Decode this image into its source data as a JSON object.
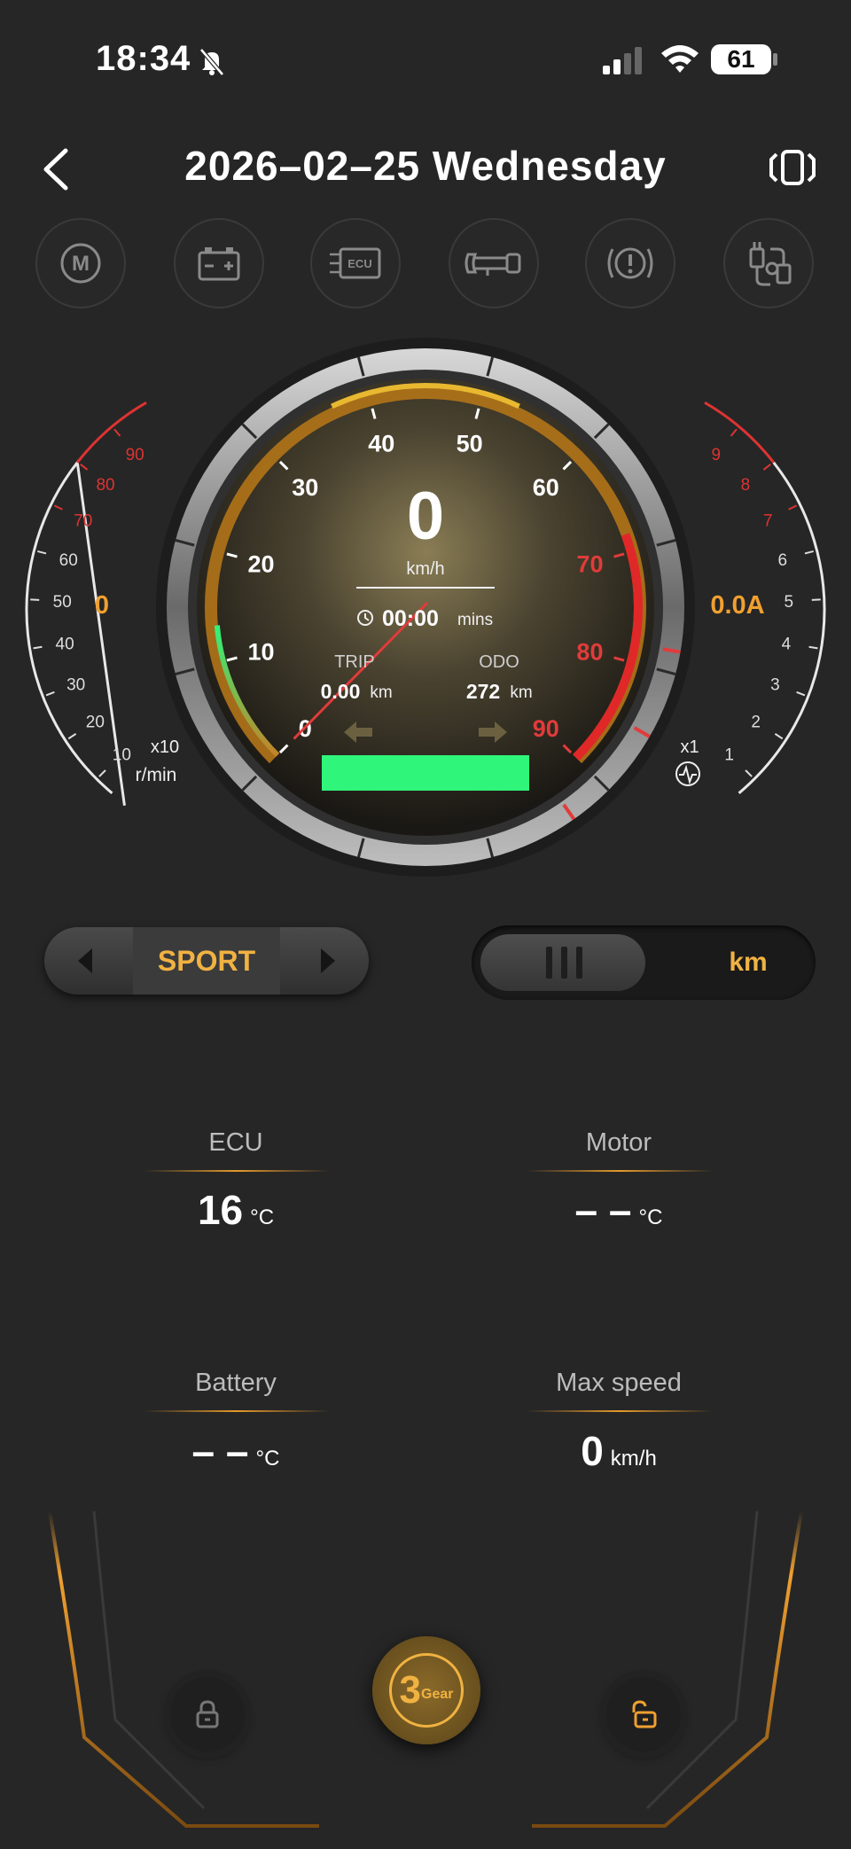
{
  "status_bar": {
    "time": "18:34",
    "battery": "61"
  },
  "header": {
    "title": "2026–02–25 Wednesday"
  },
  "icons": [
    "motor-icon",
    "battery-icon",
    "ecu-icon",
    "horn-icon",
    "brake-warning-icon",
    "charger-icon"
  ],
  "ecu_icon_text": "ECU",
  "speedometer": {
    "speed": "0",
    "speed_unit": "km/h",
    "ride_time": "00:00",
    "ride_time_unit": "mins",
    "trip_label": "TRIP",
    "trip_value": "0.00",
    "trip_unit": "km",
    "odo_label": "ODO",
    "odo_value": "272",
    "odo_unit": "km",
    "ticks": [
      "0",
      "10",
      "20",
      "30",
      "40",
      "50",
      "60",
      "70",
      "80",
      "90"
    ],
    "current_speed": 0,
    "max_scale": 90
  },
  "rpm_gauge": {
    "value": "0",
    "multiplier": "x10",
    "unit": "r/min",
    "ticks": [
      "10",
      "20",
      "30",
      "40",
      "50",
      "60",
      "70",
      "80",
      "90"
    ]
  },
  "current_gauge": {
    "value": "0.0A",
    "multiplier": "x1",
    "ticks": [
      "1",
      "2",
      "3",
      "4",
      "5",
      "6",
      "7",
      "8",
      "9"
    ]
  },
  "mode": {
    "label": "SPORT"
  },
  "unit_toggle": {
    "label": "km"
  },
  "stats": {
    "ecu": {
      "label": "ECU",
      "value": "16",
      "unit": "°C"
    },
    "motor": {
      "label": "Motor",
      "value": "– –",
      "unit": "°C"
    },
    "battery": {
      "label": "Battery",
      "value": "– –",
      "unit": "°C"
    },
    "max_speed": {
      "label": "Max speed",
      "value": "0",
      "unit": "km/h"
    }
  },
  "gear": {
    "number": "3",
    "label": "Gear"
  },
  "colors": {
    "accent": "#f0b242",
    "indicator": "#2ff57a",
    "danger": "#e33a3a"
  }
}
